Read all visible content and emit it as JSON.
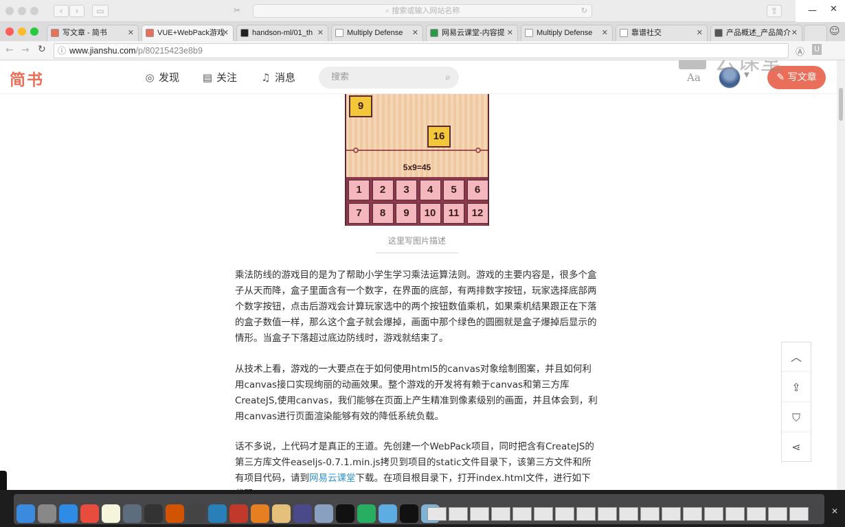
{
  "browser": {
    "top_search_placeholder": "搜索或输入网站名称",
    "url_host": "www.jianshu.com",
    "url_path": "/p/80215423e8b9",
    "tabs": [
      {
        "label": "写文章 - 简书",
        "color": "#ea6f5a",
        "active": false
      },
      {
        "label": "VUE+WebPack游戏",
        "color": "#ea6f5a",
        "active": true
      },
      {
        "label": "handson-ml/01_th",
        "color": "#222222",
        "active": false
      },
      {
        "label": "Multiply Defense",
        "color": "#ffffff",
        "active": false
      },
      {
        "label": "网易云课堂-内容提",
        "color": "#2a9a4a",
        "active": false
      },
      {
        "label": "Multiply Defense",
        "color": "#ffffff",
        "active": false
      },
      {
        "label": "靠谱社交",
        "color": "#ffffff",
        "active": false
      },
      {
        "label": "产品概述_产品简介",
        "color": "#555555",
        "active": false
      }
    ]
  },
  "site": {
    "logo": "简书",
    "nav": {
      "discover": "发现",
      "follow": "关注",
      "messages": "消息"
    },
    "search_placeholder": "搜索",
    "font_toggle": "Aa",
    "write_button": "写文章",
    "accent_color": "#ea6f5a"
  },
  "watermark": "云课堂",
  "game_image": {
    "falling_boxes": [
      "9",
      "16"
    ],
    "formula": "5x9=45",
    "keys_row1": [
      "1",
      "2",
      "3",
      "4",
      "5",
      "6"
    ],
    "keys_row2": [
      "7",
      "8",
      "9",
      "10",
      "11",
      "12"
    ]
  },
  "caption": "这里写图片描述",
  "article": {
    "p1": "乘法防线的游戏目的是为了帮助小学生学习乘法运算法则。游戏的主要内容是，很多个盒子从天而降，盒子里面含有一个数字，在界面的底部，有两排数字按钮，玩家选择底部两个数字按钮，点击后游戏会计算玩家选中的两个按钮数值乘机，如果乘机结果跟正在下落的盒子数值一样，那么这个盒子就会爆掉，画面中那个绿色的圆圈就是盒子爆掉后显示的情形。当盒子下落超过底边防线时，游戏就结束了。",
    "p2": "从技术上看，游戏的一大要点在于如何使用html5的canvas对象绘制图案，并且如何利用canvas接口实现绚丽的动画效果。整个游戏的开发将有赖于canvas和第三方库CreateJS,使用canvas，我们能够在页面上产生精准到像素级别的画面，并且体会到，利用canvas进行页面渲染能够有效的降低系统负载。",
    "p3_before": "话不多说，上代码才是真正的王道。先创建一个WebPack项目，同时把含有CreateJS的第三方库文件easeljs-0.7.1.min.js拷贝到项目的static文件目录下，该第三方文件和所有项目代码，请到",
    "p3_link": "网易云课堂",
    "p3_after": "下载。在项目根目录下，打开index.html文件，进行如下代码"
  },
  "side_tools": [
    "chevron-up-icon",
    "upload-icon",
    "bookmark-icon",
    "share-icon"
  ]
}
